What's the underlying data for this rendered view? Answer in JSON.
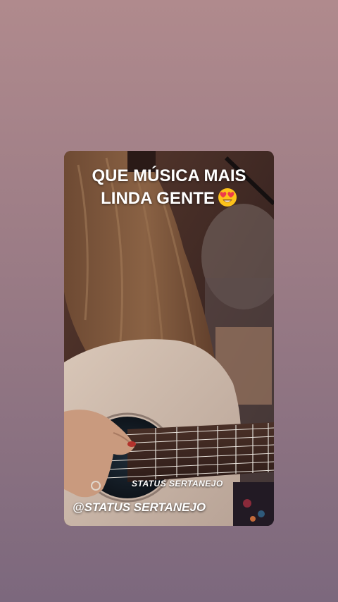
{
  "story": {
    "caption_line1": "QUE MÚSICA MAIS",
    "caption_line2": "LINDA GENTE",
    "caption_emoji": "heart-eyes-emoji",
    "watermark": "STATUS SERTANEJO",
    "handle": "@STATUS SERTANEJO"
  },
  "colors": {
    "background_top": "#b08a8d",
    "background_bottom": "#7c687d",
    "caption_text": "#ffffff"
  }
}
